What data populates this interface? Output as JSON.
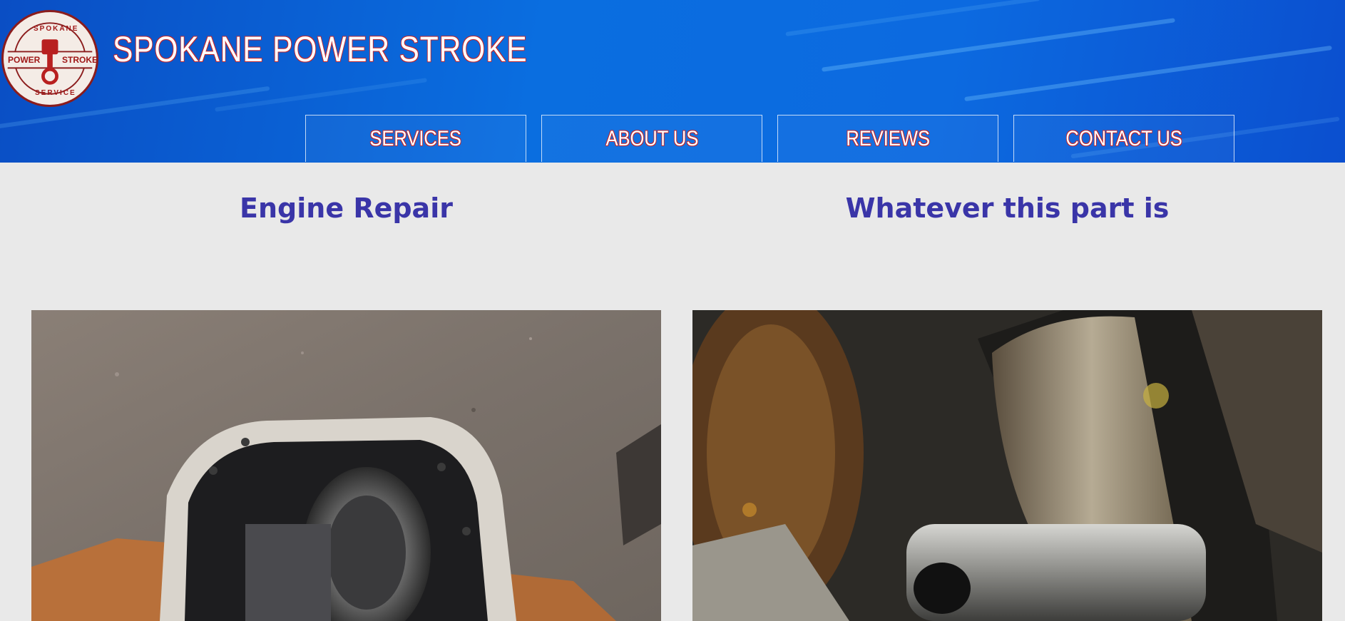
{
  "site": {
    "title": "SPOKANE POWER STROKE",
    "logo": {
      "top_text": "SPOKANE",
      "bottom_text": "SERVICE",
      "left_text": "POWER",
      "right_text": "STROKE",
      "icon": "piston-icon"
    }
  },
  "nav": {
    "items": [
      {
        "label": "SERVICES"
      },
      {
        "label": "ABOUT US"
      },
      {
        "label": "REVIEWS"
      },
      {
        "label": "CONTACT US"
      }
    ]
  },
  "main": {
    "columns": [
      {
        "title": "Engine Repair",
        "image": "differential-photo"
      },
      {
        "title": "Whatever this part is",
        "image": "crankshaft-photo"
      }
    ]
  },
  "colors": {
    "header_blue": "#0a6ee0",
    "accent_red": "#c0262d",
    "heading_purple": "#3a35a8",
    "page_bg": "#e9e9e9"
  }
}
